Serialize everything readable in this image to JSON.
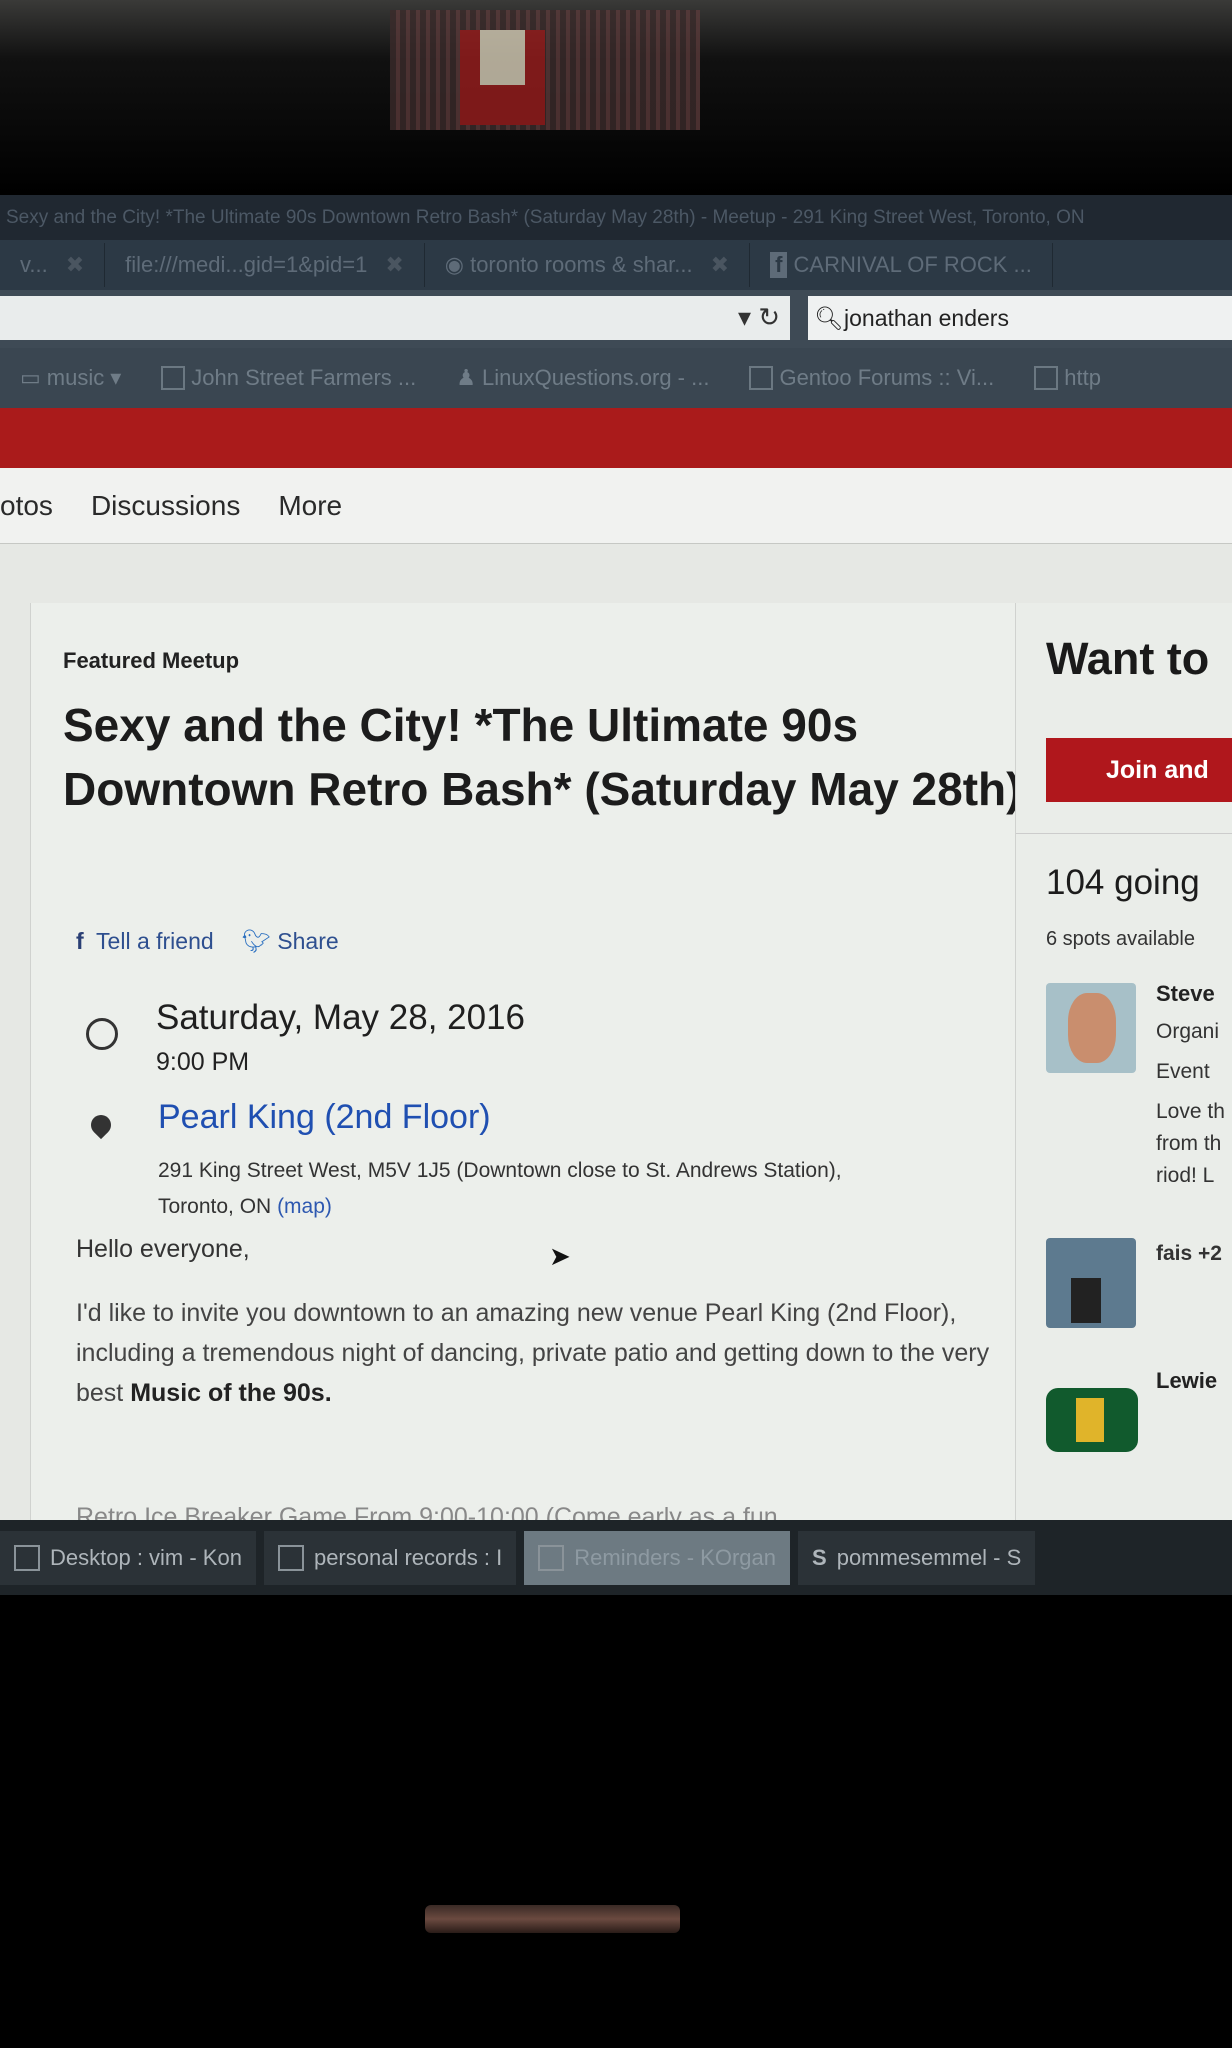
{
  "window": {
    "title": "Sexy and the City! *The Ultimate 90s Downtown Retro Bash* (Saturday May 28th) - Meetup - 291 King Street West, Toronto, ON"
  },
  "tabs": [
    {
      "label": "v..."
    },
    {
      "label": "file:///medi...gid=1&pid=1"
    },
    {
      "label": "toronto rooms & shar..."
    },
    {
      "label": "CARNIVAL OF ROCK ..."
    }
  ],
  "search": {
    "value": "jonathan enders"
  },
  "bookmarks": [
    {
      "label": "music"
    },
    {
      "label": "John Street Farmers ..."
    },
    {
      "label": "LinuxQuestions.org - ..."
    },
    {
      "label": "Gentoo Forums :: Vi..."
    },
    {
      "label": "http"
    }
  ],
  "nav": {
    "items": [
      "otos",
      "Discussions",
      "More"
    ]
  },
  "event": {
    "featured_label": "Featured Meetup",
    "title": "Sexy and the City! *The Ultimate 90s Downtown Retro Bash* (Saturday May 28th)",
    "share_facebook": "Tell a friend",
    "share_twitter": "Share",
    "date": "Saturday, May 28, 2016",
    "time": "9:00 PM",
    "venue": "Pearl King (2nd Floor)",
    "address_line1": "291 King Street West, M5V 1J5 (Downtown close to St. Andrews Station),",
    "address_line2": "Toronto, ON",
    "map_link": "(map)",
    "greeting": "Hello everyone,",
    "body_start": "I'd like to invite you downtown to an amazing new venue Pearl King (2nd Floor), including a tremendous night of dancing, private patio and getting down to the very best ",
    "body_bold": "Music of the 90s.",
    "cutoff_line": "Retro Ice Breaker Game From 9:00-10:00 (Come early as a fun"
  },
  "sidebar": {
    "want_to": "Want to",
    "join_button": "Join and",
    "going": "104 going",
    "spots": "6 spots available",
    "organizer_name": "Steve",
    "organizer_role": "Organi",
    "organizer_role2": "Event",
    "organizer_quote": "Love th from th riod! L",
    "member2": "fais +2",
    "member3": "Lewie"
  },
  "taskbar": [
    {
      "label": "Desktop : vim - Kon"
    },
    {
      "label": "personal records : I"
    },
    {
      "label": "Reminders - KOrgan"
    },
    {
      "label": "pommesemmel - S"
    }
  ],
  "colors": {
    "accent_red": "#aa1b1b",
    "link_blue": "#1f4fb1"
  }
}
